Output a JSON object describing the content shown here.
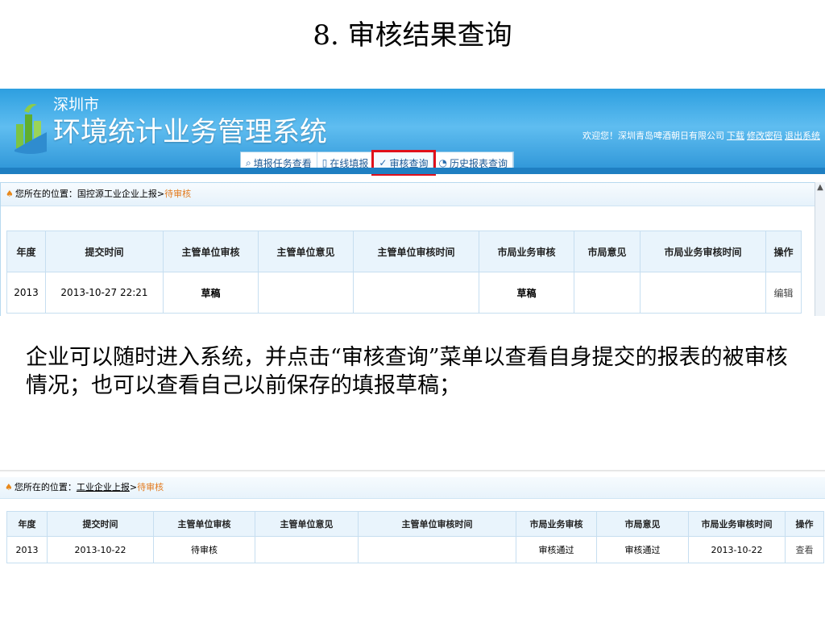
{
  "slide_title": "8. 审核结果查询",
  "app": {
    "city": "深圳市",
    "system_name": "环境统计业务管理系统",
    "welcome_text": "欢迎您！深圳青岛啤酒朝日有限公司",
    "links": {
      "download": "下载",
      "change_password": "修改密码",
      "logout": "退出系统"
    },
    "nav_tabs": [
      {
        "label": "填报任务查看",
        "icon": "search-icon"
      },
      {
        "label": "在线填报",
        "icon": "document-icon"
      },
      {
        "label": "审核查询",
        "icon": "check-icon"
      },
      {
        "label": "历史报表查询",
        "icon": "history-icon"
      }
    ],
    "highlight_color": "#e0101a"
  },
  "screenshot1": {
    "crumb_prefix": "您所在的位置：国控源工业企业上报",
    "crumb_sep": ">",
    "crumb_current": "待审核",
    "headers": [
      "年度",
      "提交时间",
      "主管单位审核",
      "主管单位意见",
      "主管单位审核时间",
      "市局业务审核",
      "市局意见",
      "市局业务审核时间",
      "操作"
    ],
    "row": [
      "2013",
      "2013-10-27 22:21",
      "草稿",
      "",
      "",
      "草稿",
      "",
      "",
      "编辑"
    ]
  },
  "paragraph": "企业可以随时进入系统，并点击“审核查询”菜单以查看自身提交的报表的被审核情况；也可以查看自己以前保存的填报草稿；",
  "screenshot2": {
    "crumb_label": "您所在的位置：",
    "crumb_link": "工业企业上报",
    "crumb_sep": ">",
    "crumb_current": "待审核",
    "headers": [
      "年度",
      "提交时间",
      "主管单位审核",
      "主管单位意见",
      "主管单位审核时间",
      "市局业务审核",
      "市局意见",
      "市局业务审核时间",
      "操作"
    ],
    "row": [
      "2013",
      "2013-10-22",
      "待审核",
      "",
      "",
      "审核通过",
      "审核通过",
      "2013-10-22",
      "查看"
    ]
  }
}
